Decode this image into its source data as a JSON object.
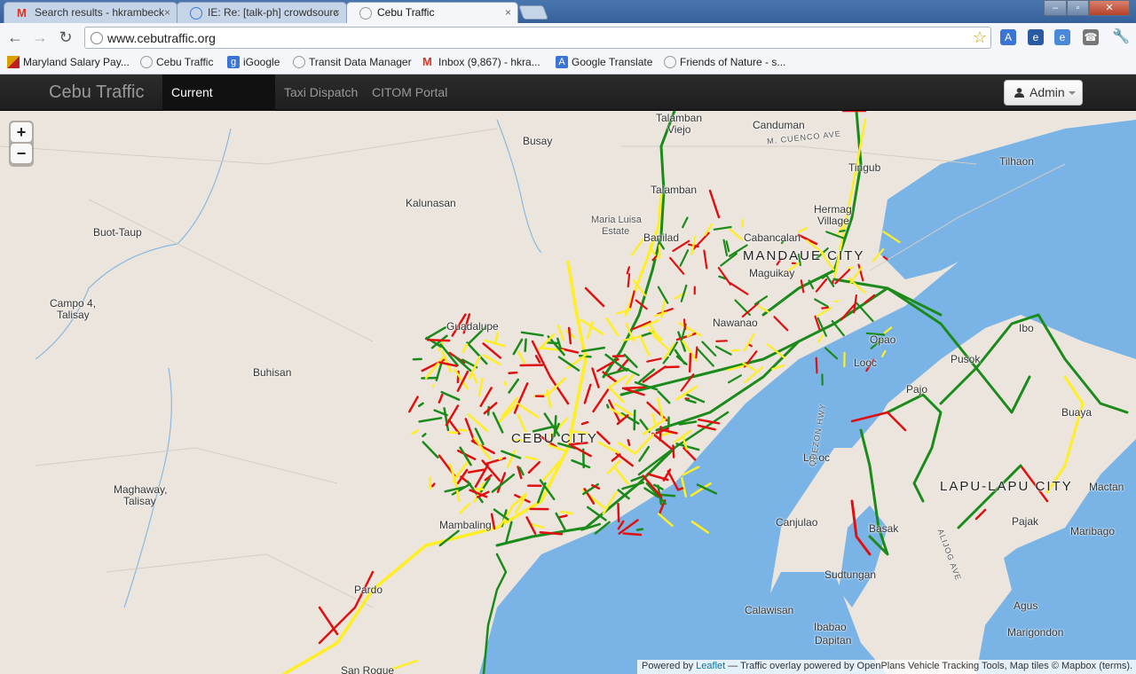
{
  "browser": {
    "tabs": [
      {
        "title": "Search results - hkrambeck"
      },
      {
        "title": "IE: Re: [talk-ph] crowdsourc"
      },
      {
        "title": "Cebu Traffic"
      }
    ],
    "close_glyph": "×",
    "window_controls": {
      "minimize": "–",
      "maximize": "▫",
      "close": "✕"
    },
    "url": "www.cebutraffic.org",
    "bookmarks": [
      {
        "label": "Maryland Salary Pay..."
      },
      {
        "label": "Cebu Traffic"
      },
      {
        "label": "iGoogle"
      },
      {
        "label": "Transit Data Manager"
      },
      {
        "label": "Inbox (9,867) - hkra..."
      },
      {
        "label": "Google Translate"
      },
      {
        "label": "Friends of Nature - s..."
      }
    ]
  },
  "navbar": {
    "brand": "Cebu Traffic",
    "links": [
      {
        "label": "Current Conditions",
        "active": true
      },
      {
        "label": "Taxi Dispatch",
        "active": false
      },
      {
        "label": "CITOM Portal",
        "active": false
      }
    ],
    "admin_label": "Admin"
  },
  "map": {
    "zoom_in": "+",
    "zoom_out": "−",
    "labels": {
      "talamban_top": "Talamban",
      "viejo": "Viejo",
      "canduman": "Canduman",
      "m_cuenco": "M. CUENCO AVE",
      "tilhaon": "Tilhaon",
      "busay": "Busay",
      "tingub": "Tingub",
      "talamban": "Talamban",
      "hermag": "Hermag",
      "village": "Village",
      "kalunasan": "Kalunasan",
      "maria_luisa": "Maria Luisa",
      "estate": "Estate",
      "buot_taup": "Buot-Taup",
      "banilad": "Banilad",
      "cabancalan": "Cabancalan",
      "mandaue": "MANDAUE CITY",
      "maguikay": "Maguikay",
      "campo4": "Campo 4,",
      "talisay1": "Talisay",
      "guadalupe": "Guadalupe",
      "nawanao": "Nawanao",
      "opao": "Opao",
      "ibo": "Ibo",
      "buhisan": "Buhisan",
      "looc": "Looc",
      "pusok": "Pusok",
      "pajo": "Pajo",
      "cebu_city": "CEBU CITY",
      "buaya": "Buaya",
      "lo_oc": "Lo-oc",
      "lapu": "LAPU-LAPU CITY",
      "mactan": "Mactan",
      "maghaway": "Maghaway,",
      "talisay2": "Talisay",
      "quezon_hwy": "QUEZON HWY",
      "mambaling": "Mambaling",
      "canjulao": "Canjulao",
      "pajak": "Pajak",
      "basak": "Basak",
      "maribago": "Maribago",
      "pardo": "Pardo",
      "sudtungan": "Sudtungan",
      "agus": "Agus",
      "calawisan": "Calawisan",
      "ibabao": "Ibabao",
      "dapitan": "Dapitan",
      "marigondon": "Marigondon",
      "san_roque": "San Roque",
      "lapu_ave": "ALIJOG AVE"
    },
    "colors": {
      "free": "#1a8a1a",
      "slow": "#ffee22",
      "jam": "#e01010",
      "water": "#7ab4e6",
      "land": "#ebe5dd"
    }
  },
  "attribution": {
    "prefix": "Powered by ",
    "leaflet": "Leaflet",
    "rest": " — Traffic overlay powered by OpenPlans Vehicle Tracking Tools, Map tiles © Mapbox (terms)."
  }
}
